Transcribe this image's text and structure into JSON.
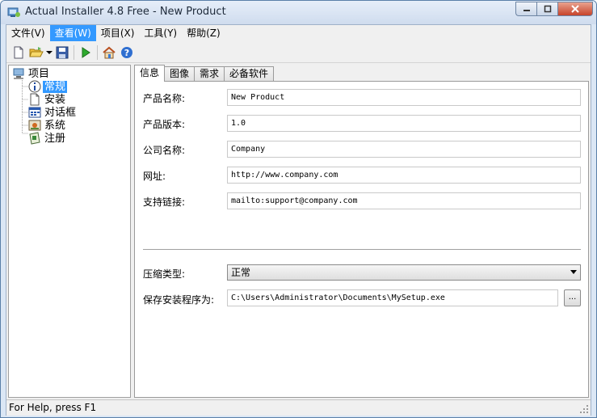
{
  "window": {
    "title": "Actual Installer 4.8 Free - New Product",
    "icons": {
      "app": "installer-app-icon",
      "minimize": "minimize-icon",
      "maximize": "maximize-icon",
      "close": "close-icon"
    }
  },
  "menu": [
    {
      "label": "文件(V)"
    },
    {
      "label": "查看(W)",
      "active": true
    },
    {
      "label": "项目(X)"
    },
    {
      "label": "工具(Y)"
    },
    {
      "label": "帮助(Z)"
    }
  ],
  "toolbar": {
    "icons": [
      "new-file-icon",
      "open-folder-icon",
      "dropdown-arrow-icon",
      "save-icon",
      "run-build-icon",
      "home-icon",
      "help-icon"
    ]
  },
  "tree": {
    "root": "项目",
    "items": [
      {
        "label": "常规",
        "icon": "info-icon",
        "selected": true
      },
      {
        "label": "安装",
        "icon": "document-icon"
      },
      {
        "label": "对话框",
        "icon": "dialog-icon"
      },
      {
        "label": "系统",
        "icon": "system-icon"
      },
      {
        "label": "注册",
        "icon": "registry-icon"
      }
    ]
  },
  "tabs": [
    {
      "label": "信息",
      "active": true
    },
    {
      "label": "图像"
    },
    {
      "label": "需求"
    },
    {
      "label": "必备软件"
    }
  ],
  "form": {
    "product_name": {
      "label": "产品名称:",
      "value": "New Product"
    },
    "product_version": {
      "label": "产品版本:",
      "value": "1.0"
    },
    "company_name": {
      "label": "公司名称:",
      "value": "Company"
    },
    "website": {
      "label": "网址:",
      "value": "http://www.company.com"
    },
    "support_link": {
      "label": "支持链接:",
      "value": "mailto:support@company.com"
    },
    "compression": {
      "label": "压缩类型:",
      "value": "正常"
    },
    "save_as": {
      "label": "保存安装程序为:",
      "value": "C:\\Users\\Administrator\\Documents\\MySetup.exe",
      "browse_label": "..."
    }
  },
  "status": {
    "text": "For Help, press F1"
  }
}
